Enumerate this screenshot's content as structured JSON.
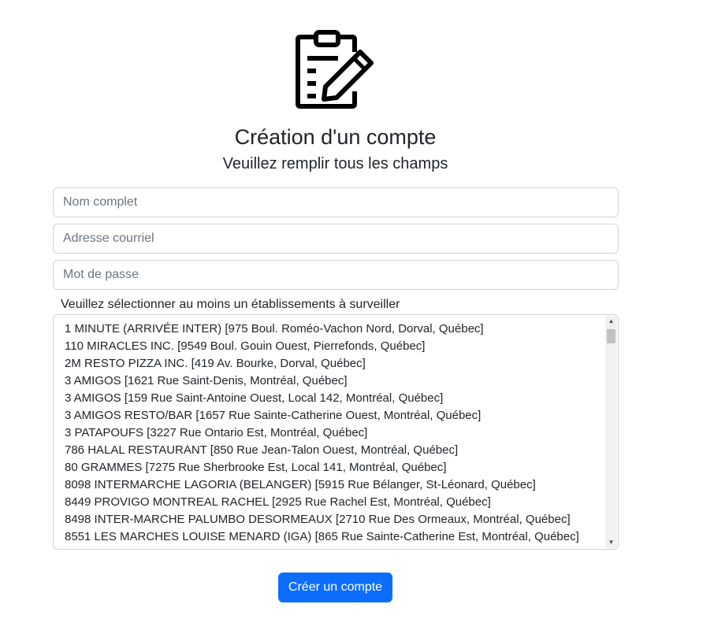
{
  "header": {
    "icon": "clipboard-edit-icon",
    "title": "Création d'un compte",
    "subtitle": "Veuillez remplir tous les champs"
  },
  "form": {
    "name_placeholder": "Nom complet",
    "email_placeholder": "Adresse courriel",
    "password_placeholder": "Mot de passe",
    "select_label": "Veuillez sélectionner au moins un établissements à surveiller",
    "establishments": [
      "1 MINUTE (ARRIVÉE INTER) [975 Boul. Roméo-Vachon Nord, Dorval, Québec]",
      "110 MIRACLES INC. [9549 Boul. Gouin Ouest, Pierrefonds, Québec]",
      "2M RESTO PIZZA INC. [419 Av. Bourke, Dorval, Québec]",
      "3 AMIGOS [1621 Rue Saint-Denis, Montréal, Québec]",
      "3 AMIGOS [159 Rue Saint-Antoine Ouest, Local 142, Montréal, Québec]",
      "3 AMIGOS RESTO/BAR [1657 Rue Sainte-Catherine Ouest, Montréal, Québec]",
      "3 PATAPOUFS [3227 Rue Ontario Est, Montréal, Québec]",
      "786 HALAL RESTAURANT [850 Rue Jean-Talon Ouest, Montréal, Québec]",
      "80 GRAMMES [7275 Rue Sherbrooke Est, Local 141, Montréal, Québec]",
      "8098 INTERMARCHE LAGORIA (BELANGER) [5915 Rue Bélanger, St-Léonard, Québec]",
      "8449 PROVIGO MONTREAL RACHEL [2925 Rue Rachel Est, Montréal, Québec]",
      "8498 INTER-MARCHE PALUMBO DESORMEAUX [2710 Rue Des Ormeaux, Montréal, Québec]",
      "8551 LES MARCHES LOUISE MENARD (IGA) [865 Rue Sainte-Catherine Est, Montréal, Québec]"
    ],
    "submit_label": "Créer un compte"
  },
  "colors": {
    "primary": "#0d6efd",
    "text": "#212529",
    "border": "#ced4da",
    "placeholder": "#6c757d"
  }
}
